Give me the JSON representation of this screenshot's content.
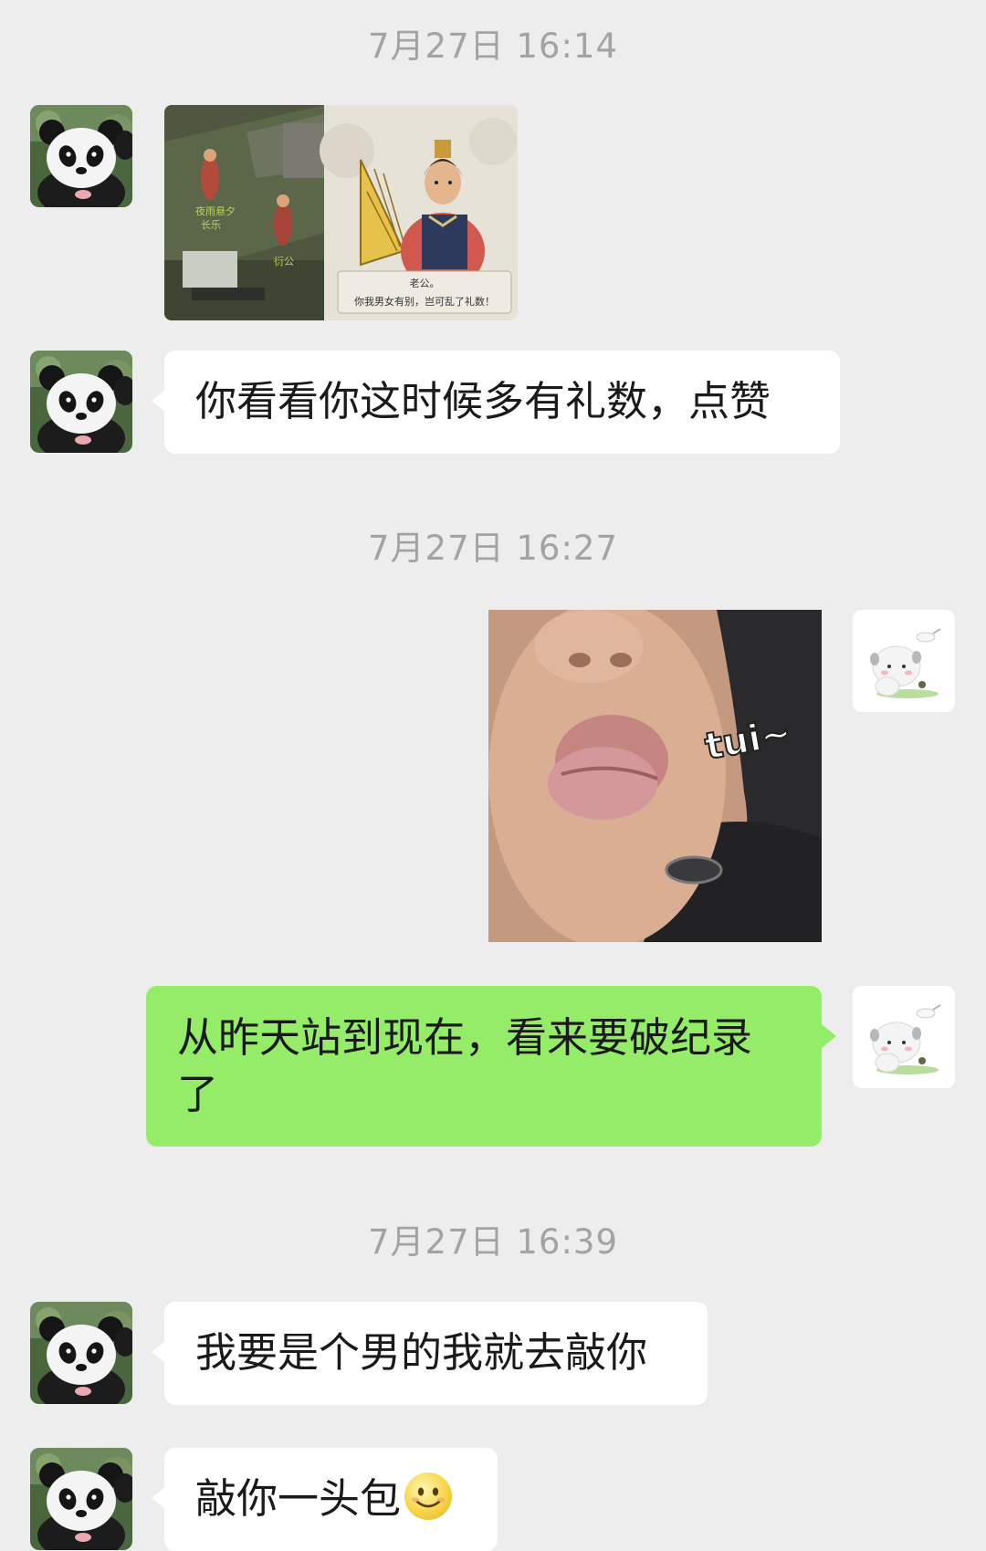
{
  "messages": {
    "ts1": "7月27日 16:14",
    "game_caption_name": "老公。",
    "game_caption_line": "你我男女有别，岂可乱了礼数！",
    "game_npc_labels": [
      "夜雨悬夕",
      "长乐",
      "衍公"
    ],
    "msg1": "你看看你这时候多有礼数，点赞",
    "ts2": "7月27日 16:27",
    "sticker_text": "tui~",
    "msg2": "从昨天站到现在，看来要破纪录了",
    "ts3": "7月27日 16:39",
    "msg3": "我要是个男的我就去敲你",
    "msg4": "敲你一头包"
  },
  "icons": {
    "left_avatar": "panda-avatar-icon",
    "right_avatar": "cartoon-sheep-avatar-icon",
    "emoji": "smiling-face-emoji-icon"
  },
  "colors": {
    "background": "#ededed",
    "left_bubble": "#ffffff",
    "right_bubble": "#95ec69",
    "timestamp": "#a3a3a3"
  }
}
